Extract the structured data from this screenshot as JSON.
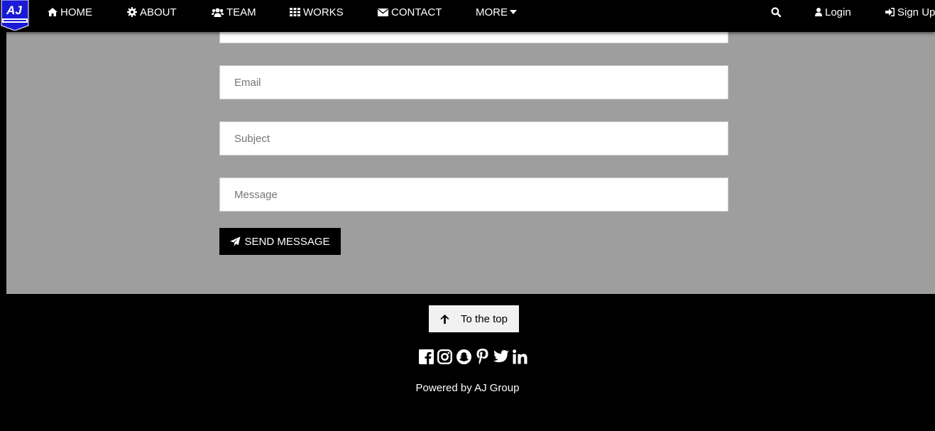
{
  "logo": {
    "text": "AJ"
  },
  "nav": {
    "home": "HOME",
    "about": "ABOUT",
    "team": "TEAM",
    "works": "WORKS",
    "contact": "CONTACT",
    "more": "MORE",
    "login": "Login",
    "signup": "Sign Up"
  },
  "form": {
    "name_placeholder": "",
    "email_placeholder": "Email",
    "subject_placeholder": "Subject",
    "message_placeholder": "Message",
    "send_label": "SEND MESSAGE"
  },
  "footer": {
    "top_label": "To the top",
    "powered": "Powered by AJ Group",
    "socials": [
      "facebook-icon",
      "instagram-icon",
      "snapchat-icon",
      "pinterest-icon",
      "twitter-icon",
      "linkedin-icon"
    ]
  },
  "colors": {
    "panel": "#9e9e9e",
    "navbar": "#000000",
    "logo_blue": "#1a1ad6"
  }
}
